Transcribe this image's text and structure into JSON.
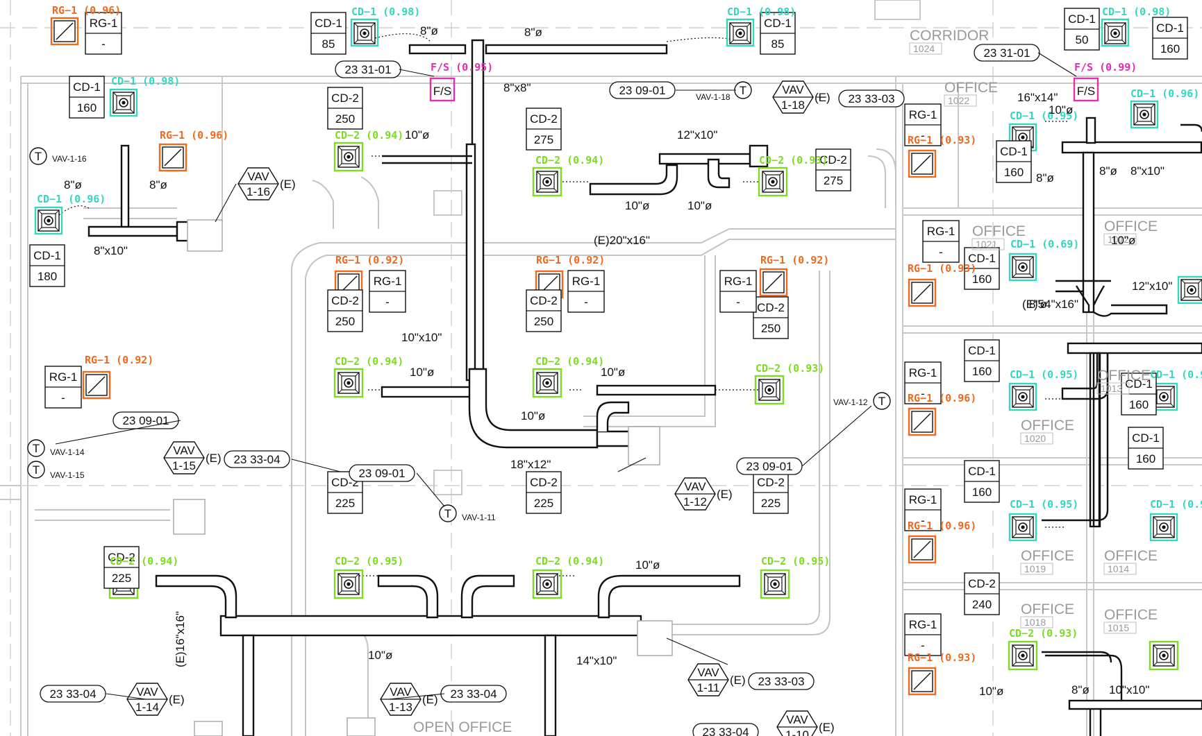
{
  "colors": {
    "cd1": "#35d6c0",
    "cd2": "#7cdc21",
    "rg1": "#ef6a1e",
    "fs": "#e02fb0",
    "wall": "#c8c8c8",
    "duct": "#111111"
  },
  "rooms": [
    {
      "name": "CORRIDOR",
      "num": "1024"
    },
    {
      "name": "OFFICE",
      "num": "1022"
    },
    {
      "name": "OFFICE",
      "num": "1021"
    },
    {
      "name": "OFFICE",
      "num": "1012"
    },
    {
      "name": "OFFICE",
      "num": "1013"
    },
    {
      "name": "OFFICE",
      "num": "1020"
    },
    {
      "name": "OFFICE",
      "num": "1019"
    },
    {
      "name": "OFFICE",
      "num": "1014"
    },
    {
      "name": "OFFICE",
      "num": "1018"
    },
    {
      "name": "OFFICE",
      "num": "1015"
    },
    {
      "name": "OPEN OFFICE",
      "num": ""
    }
  ],
  "diffuser_tags": [
    {
      "type": "CD-1",
      "cfm": "85"
    },
    {
      "type": "CD-1",
      "cfm": "85"
    },
    {
      "type": "CD-1",
      "cfm": "50"
    },
    {
      "type": "CD-1",
      "cfm": "160"
    },
    {
      "type": "CD-1",
      "cfm": "180"
    },
    {
      "type": "CD-1",
      "cfm": "180"
    },
    {
      "type": "CD-2",
      "cfm": "250"
    },
    {
      "type": "CD-2",
      "cfm": "275"
    },
    {
      "type": "CD-2",
      "cfm": "275"
    },
    {
      "type": "CD-1",
      "cfm": "160"
    },
    {
      "type": "CD-1",
      "cfm": "160"
    },
    {
      "type": "CD-2",
      "cfm": "250"
    },
    {
      "type": "CD-2",
      "cfm": "250"
    },
    {
      "type": "CD-2",
      "cfm": "250"
    },
    {
      "type": "CD-1",
      "cfm": "160"
    },
    {
      "type": "CD-1",
      "cfm": "160"
    },
    {
      "type": "CD-1",
      "cfm": "160"
    },
    {
      "type": "CD-1",
      "cfm": "160"
    },
    {
      "type": "CD-2",
      "cfm": "225"
    },
    {
      "type": "CD-2",
      "cfm": "225"
    },
    {
      "type": "CD-2",
      "cfm": "225"
    },
    {
      "type": "CD-2",
      "cfm": "225"
    },
    {
      "type": "CD-1",
      "cfm": "160"
    },
    {
      "type": "CD-2",
      "cfm": "240"
    }
  ],
  "grille_tags": [
    {
      "type": "RG-1",
      "val": "-"
    },
    {
      "type": "RG-1",
      "val": "-"
    },
    {
      "type": "RG-1",
      "val": "-"
    },
    {
      "type": "RG-1",
      "val": "-"
    },
    {
      "type": "RG-1",
      "val": "-"
    },
    {
      "type": "RG-1",
      "val": "-"
    },
    {
      "type": "RG-1",
      "val": "-"
    },
    {
      "type": "RG-1",
      "val": "-"
    },
    {
      "type": "RG-1",
      "val": "-"
    },
    {
      "type": "RG-1",
      "val": "-"
    }
  ],
  "detections": [
    "CD−1 (0.98)",
    "CD−1 (0.98)",
    "CD−1 (0.98)",
    "CD−1 (0.98)",
    "CD−1 (0.96)",
    "CD−1 (0.96)",
    "CD−1 (0.69)",
    "CD−1 (0.95)",
    "CD−1 (0.95)",
    "CD−1 (0.95)",
    "CD−1 (0.95)",
    "CD−1 (0.95)",
    "CD−2 (0.94)",
    "CD−2 (0.94)",
    "CD−2 (0.93)",
    "CD−2 (0.94)",
    "CD−2 (0.94)",
    "CD−2 (0.93)",
    "CD−2 (0.94)",
    "CD−2 (0.95)",
    "CD−2 (0.94)",
    "CD−2 (0.95)",
    "CD−2 (0.93)",
    "RG−1 (0.96)",
    "RG−1 (0.96)",
    "RG−1 (0.92)",
    "RG−1 (0.92)",
    "RG−1 (0.92)",
    "RG−1 (0.92)",
    "RG−1 (0.93)",
    "RG−1 (0.93)",
    "RG−1 (0.96)",
    "RG−1 (0.96)",
    "RG−1 (0.93)",
    "F/S (0.95)",
    "F/S (0.99)"
  ],
  "duct_sizes": [
    "8\"ø",
    "8\"ø",
    "8\"x8\"",
    "10\"ø",
    "12\"x10\"",
    "10\"ø",
    "10\"ø",
    "8\"ø",
    "8\"ø",
    "8\"x10\"",
    "(E)20\"x16\"",
    "10\"x10\"",
    "10\"ø",
    "10\"ø",
    "10\"ø",
    "18\"x12\"",
    "(E)16\"x16\"",
    "10\"ø",
    "10\"ø",
    "14\"x10\"",
    "16\"x14\"",
    "10\"ø",
    "8\"ø",
    "8\"ø",
    "8\"x10\"",
    "10\"ø",
    "12\"x10\"",
    "(E)54\"x16\"",
    "8\"ø",
    "8\"ø",
    "10\"ø",
    "10\"x10\""
  ],
  "vav_boxes": [
    {
      "top": "VAV",
      "bottom": "1-18"
    },
    {
      "top": "VAV",
      "bottom": "1-16"
    },
    {
      "top": "VAV",
      "bottom": "1-15"
    },
    {
      "top": "VAV",
      "bottom": "1-12"
    },
    {
      "top": "VAV",
      "bottom": "1-14"
    },
    {
      "top": "VAV",
      "bottom": "1-13"
    },
    {
      "top": "VAV",
      "bottom": "1-11"
    },
    {
      "top": "VAV",
      "bottom": "1-10"
    }
  ],
  "existing_mark": "(E)",
  "spec_refs": [
    "23 31-01",
    "23 31-01",
    "23 09-01",
    "23 33-03",
    "23 09-01",
    "23 33-04",
    "23 09-01",
    "23 09-01",
    "23 33-04",
    "23 33-04",
    "23 33-03",
    "23 33-04"
  ],
  "thermostats": [
    {
      "symbol": "T",
      "label": "VAV-1-18"
    },
    {
      "symbol": "T",
      "label": "VAV-1-16"
    },
    {
      "symbol": "T",
      "label": "VAV-1-14"
    },
    {
      "symbol": "T",
      "label": "VAV-1-15"
    },
    {
      "symbol": "T",
      "label": "VAV-1-11"
    },
    {
      "symbol": "T",
      "label": "VAV-1-12"
    }
  ],
  "fire_smoke": [
    {
      "label": "F/S"
    },
    {
      "label": "F/S"
    }
  ]
}
